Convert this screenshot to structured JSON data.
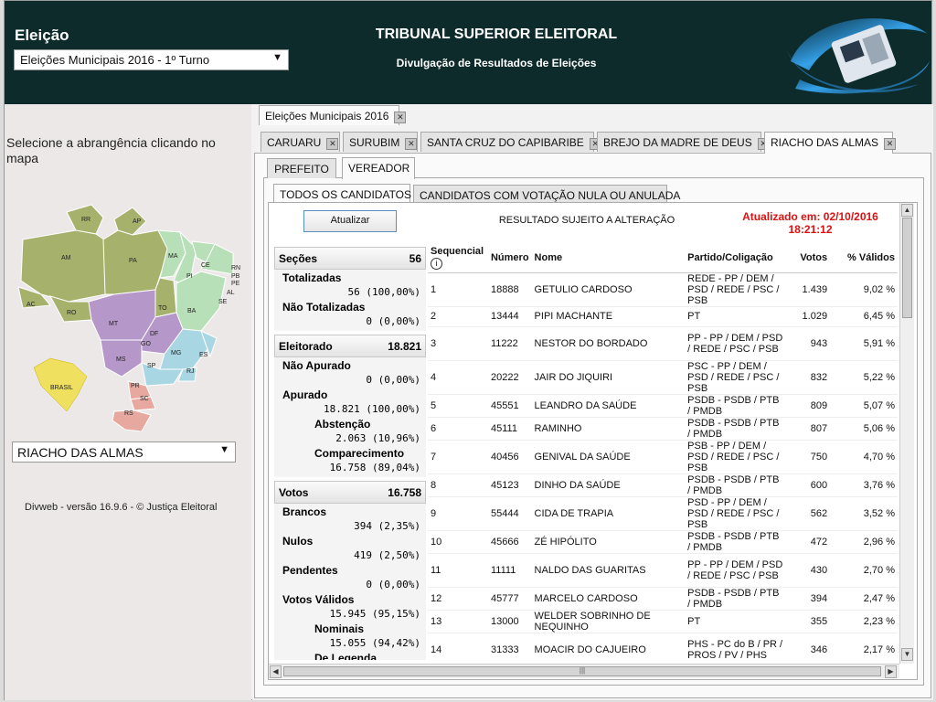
{
  "header": {
    "eleicao_title": "Eleição",
    "eleicao_selected": "Eleições Municipais 2016 - 1º Turno",
    "title": "TRIBUNAL SUPERIOR ELEITORAL",
    "subtitle": "Divulgação de Resultados de Eleições"
  },
  "left": {
    "instruction": "Selecione a abrangência clicando no mapa",
    "map_labels": [
      "RR",
      "AP",
      "AM",
      "PA",
      "MA",
      "CE",
      "RN",
      "PB",
      "PE",
      "AL",
      "SE",
      "PI",
      "AC",
      "RO",
      "TO",
      "BA",
      "MT",
      "GO",
      "DF",
      "MG",
      "ES",
      "MS",
      "SP",
      "RJ",
      "PR",
      "SC",
      "RS",
      "BRASIL"
    ],
    "city_selected": "RIACHO DAS ALMAS",
    "version": "Divweb - versão 16.9.6 - © Justiça Eleitoral"
  },
  "tabs": {
    "election": "Eleições Municipais 2016",
    "cities": [
      "CARUARU",
      "SURUBIM",
      "SANTA CRUZ DO CAPIBARIBE",
      "BREJO DA MADRE DE DEUS",
      "RIACHO DAS ALMAS"
    ],
    "roles": [
      "PREFEITO",
      "VEREADOR"
    ],
    "views": [
      "TODOS OS CANDIDATOS",
      "CANDIDATOS COM VOTAÇÃO NULA OU ANULADA"
    ],
    "close_symbol": "✕"
  },
  "content": {
    "update_button": "Atualizar",
    "warning": "RESULTADO SUJEITO A ALTERAÇÃO",
    "updated_line1": "Atualizado em: 02/10/2016",
    "updated_line2": "18:21:12"
  },
  "stats": {
    "secoes": {
      "label": "Seções",
      "value": "56"
    },
    "totalizadas": {
      "label": "Totalizadas",
      "value": "56 (100,00%)"
    },
    "nao_totalizadas": {
      "label": "Não Totalizadas",
      "value": "0 (0,00%)"
    },
    "eleitorado": {
      "label": "Eleitorado",
      "value": "18.821"
    },
    "nao_apurado": {
      "label": "Não Apurado",
      "value": "0 (0,00%)"
    },
    "apurado": {
      "label": "Apurado",
      "value": "18.821 (100,00%)"
    },
    "abstencao": {
      "label": "Abstenção",
      "value": "2.063 (10,96%)"
    },
    "comparecimento": {
      "label": "Comparecimento",
      "value": "16.758 (89,04%)"
    },
    "votos": {
      "label": "Votos",
      "value": "16.758"
    },
    "brancos": {
      "label": "Brancos",
      "value": "394 (2,35%)"
    },
    "nulos": {
      "label": "Nulos",
      "value": "419 (2,50%)"
    },
    "pendentes": {
      "label": "Pendentes",
      "value": "0 (0,00%)"
    },
    "validos": {
      "label": "Votos Válidos",
      "value": "15.945 (95,15%)"
    },
    "nominais": {
      "label": "Nominais",
      "value": "15.055 (94,42%)"
    },
    "legenda": {
      "label": "De Legenda"
    }
  },
  "table": {
    "headers": {
      "seq": "Sequencial",
      "seq_info": "i",
      "numero": "Número",
      "nome": "Nome",
      "partido": "Partido/Coligação",
      "votos": "Votos",
      "pct": "% Válidos"
    },
    "rows": [
      {
        "seq": "1",
        "numero": "18888",
        "nome": "GETULIO CARDOSO",
        "partido": "REDE - PP / DEM / PSD / REDE / PSC / PSB",
        "votos": "1.439",
        "pct": "9,02 %"
      },
      {
        "seq": "2",
        "numero": "13444",
        "nome": "PIPI MACHANTE",
        "partido": "PT",
        "votos": "1.029",
        "pct": "6,45 %"
      },
      {
        "seq": "3",
        "numero": "11222",
        "nome": "NESTOR DO BORDADO",
        "partido": "PP - PP / DEM / PSD / REDE / PSC / PSB",
        "votos": "943",
        "pct": "5,91 %"
      },
      {
        "seq": "4",
        "numero": "20222",
        "nome": "JAIR DO JIQUIRI",
        "partido": "PSC - PP / DEM / PSD / REDE / PSC / PSB",
        "votos": "832",
        "pct": "5,22 %"
      },
      {
        "seq": "5",
        "numero": "45551",
        "nome": "LEANDRO DA SAÚDE",
        "partido": "PSDB - PSDB / PTB / PMDB",
        "votos": "809",
        "pct": "5,07 %"
      },
      {
        "seq": "6",
        "numero": "45111",
        "nome": "RAMINHO",
        "partido": "PSDB - PSDB / PTB / PMDB",
        "votos": "807",
        "pct": "5,06 %"
      },
      {
        "seq": "7",
        "numero": "40456",
        "nome": "GENIVAL DA SAÚDE",
        "partido": "PSB - PP / DEM / PSD / REDE / PSC / PSB",
        "votos": "750",
        "pct": "4,70 %"
      },
      {
        "seq": "8",
        "numero": "45123",
        "nome": "DINHO DA SAÚDE",
        "partido": "PSDB - PSDB / PTB / PMDB",
        "votos": "600",
        "pct": "3,76 %"
      },
      {
        "seq": "9",
        "numero": "55444",
        "nome": "CIDA DE TRAPIA",
        "partido": "PSD - PP / DEM / PSD / REDE / PSC / PSB",
        "votos": "562",
        "pct": "3,52 %"
      },
      {
        "seq": "10",
        "numero": "45666",
        "nome": "ZÉ HIPÓLITO",
        "partido": "PSDB - PSDB / PTB / PMDB",
        "votos": "472",
        "pct": "2,96 %"
      },
      {
        "seq": "11",
        "numero": "11111",
        "nome": "NALDO DAS GUARITAS",
        "partido": "PP - PP / DEM / PSD / REDE / PSC / PSB",
        "votos": "430",
        "pct": "2,70 %"
      },
      {
        "seq": "12",
        "numero": "45777",
        "nome": "MARCELO CARDOSO",
        "partido": "PSDB - PSDB / PTB / PMDB",
        "votos": "394",
        "pct": "2,47 %"
      },
      {
        "seq": "13",
        "numero": "13000",
        "nome": "WELDER SOBRINHO DE NEQUINHO",
        "partido": "PT",
        "votos": "355",
        "pct": "2,23 %"
      },
      {
        "seq": "14",
        "numero": "31333",
        "nome": "MOACIR DO CAJUEIRO",
        "partido": "PHS - PC do B / PR / PROS / PV / PHS",
        "votos": "346",
        "pct": "2,17 %"
      }
    ]
  },
  "colors": {
    "header_bg": "#0d2b2b",
    "updated_text": "#dd1111"
  }
}
